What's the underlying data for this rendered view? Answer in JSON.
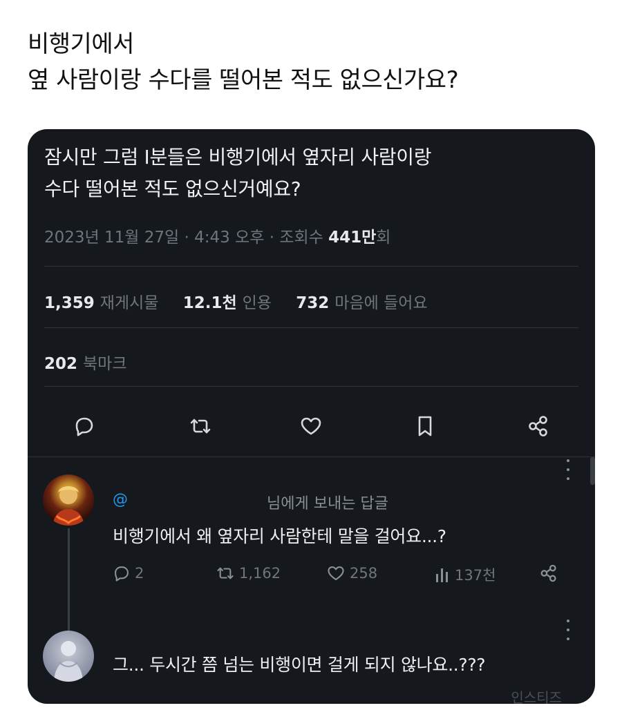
{
  "caption": {
    "line1": "비행기에서",
    "line2": "옆 사람이랑 수다를 떨어본 적도 없으신가요?"
  },
  "tweet": {
    "text_line1": "잠시만 그럼 I분들은 비행기에서 옆자리 사람이랑",
    "text_line2": "수다 떨어본 적도 없으신거예요?",
    "meta_prefix": "2023년 11월 27일 · 4:43 오후 · 조회수 ",
    "views_num": "441만",
    "views_suffix": "회",
    "retweets_num": "1,359",
    "retweets_label": "재게시물",
    "quotes_num": "12.1천",
    "quotes_label": "인용",
    "likes_num": "732",
    "likes_label": "마음에 들어요",
    "bookmarks_num": "202",
    "bookmarks_label": "북마크",
    "actions": [
      "reply-icon",
      "retweet-icon",
      "heart-icon",
      "bookmark-icon",
      "share-icon"
    ]
  },
  "reply1": {
    "mention": "@",
    "reply_to": "님에게 보내는 답글",
    "text": "비행기에서 왜 옆자리 사람한테 말을 걸어요...?",
    "replies": "2",
    "retweets": "1,162",
    "likes": "258",
    "views": "137천"
  },
  "reply2": {
    "text": "그... 두시간 쯤 넘는 비행이면 걸게 되지 않나요..???"
  },
  "watermark": "인스티즈",
  "colors": {
    "card_bg": "#15181d",
    "accent": "#1d9bf0",
    "muted": "#71767b"
  }
}
